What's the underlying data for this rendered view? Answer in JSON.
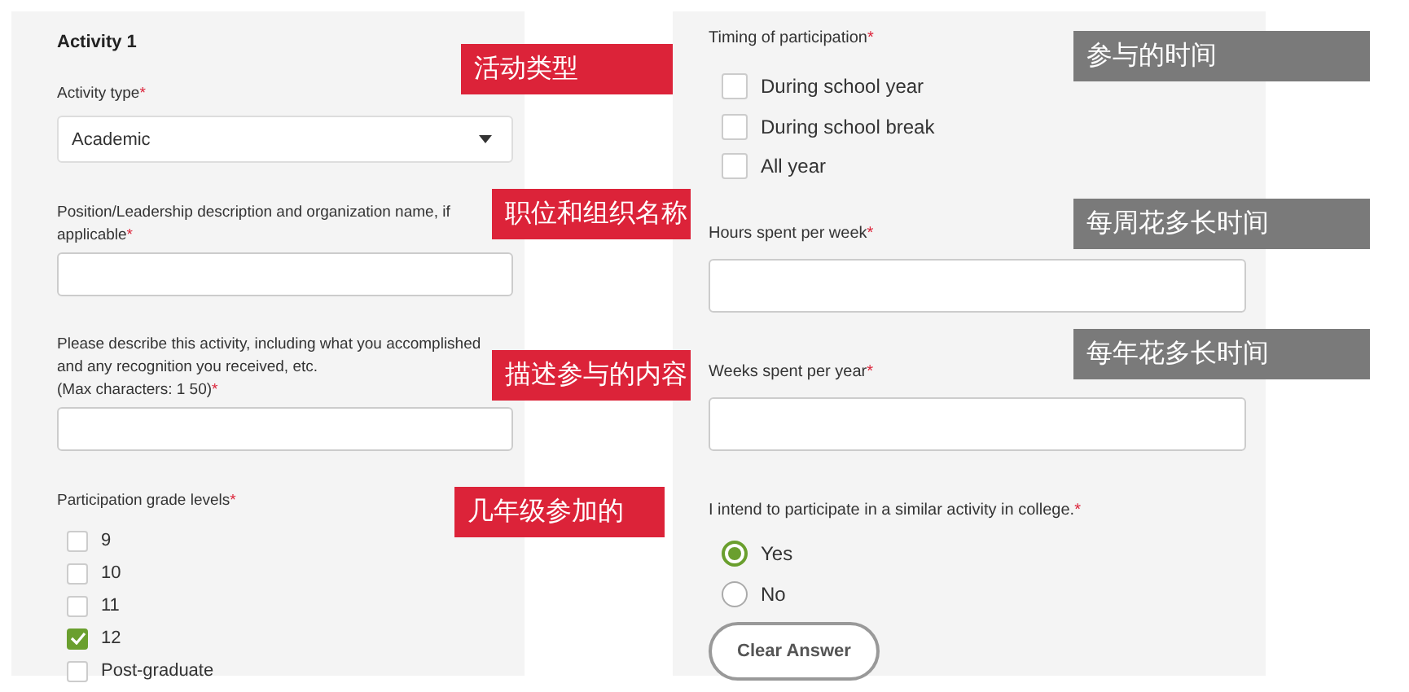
{
  "left_panel": {
    "title": "Activity 1",
    "fields": [
      {
        "kind": "select",
        "label": "Activity type",
        "required_mark": "*",
        "value": "Academic"
      },
      {
        "kind": "text",
        "label": "Position/Leadership description and organization name, if applicable",
        "required_mark": "*"
      },
      {
        "kind": "text",
        "label": "Please describe this activity, including what you accomplished and any recognition you received, etc.\n(Max characters: 1 50)",
        "required_mark": "*"
      },
      {
        "kind": "checkboxes",
        "label": "Participation grade levels",
        "required_mark": "*",
        "options": [
          {
            "label": "9",
            "checked": false
          },
          {
            "label": "10",
            "checked": false
          },
          {
            "label": "11",
            "checked": false
          },
          {
            "label": "12",
            "checked": true
          },
          {
            "label": "Post-graduate",
            "checked": false
          }
        ]
      }
    ]
  },
  "right_panel": {
    "fields": [
      {
        "kind": "checkboxes",
        "label": "Timing of participation",
        "required_mark": "*",
        "options": [
          {
            "label": "During school year",
            "checked": false
          },
          {
            "label": "During school break",
            "checked": false
          },
          {
            "label": "All year",
            "checked": false
          }
        ]
      },
      {
        "kind": "text",
        "label": "Hours spent per week",
        "required_mark": "*"
      },
      {
        "kind": "text",
        "label": "Weeks spent per year",
        "required_mark": "*"
      },
      {
        "kind": "radios",
        "label": "I intend to participate in a similar activity in college.",
        "required_mark": "*",
        "options": [
          {
            "label": "Yes",
            "selected": true
          },
          {
            "label": "No",
            "selected": false
          }
        ],
        "button": "Clear Answer"
      }
    ]
  },
  "callouts": [
    {
      "text": "活动类型",
      "color": "#dc2339"
    },
    {
      "text": "职位和组织名称",
      "color": "#dc2339"
    },
    {
      "text": "描述参与的内容",
      "color": "#dc2339"
    },
    {
      "text": "几年级参加的",
      "color": "#dc2339"
    },
    {
      "text": "参与的时间",
      "color": "#7a7a7a"
    },
    {
      "text": "每周花多长时间",
      "color": "#7a7a7a"
    },
    {
      "text": "每年花多长时间",
      "color": "#7a7a7a"
    }
  ]
}
